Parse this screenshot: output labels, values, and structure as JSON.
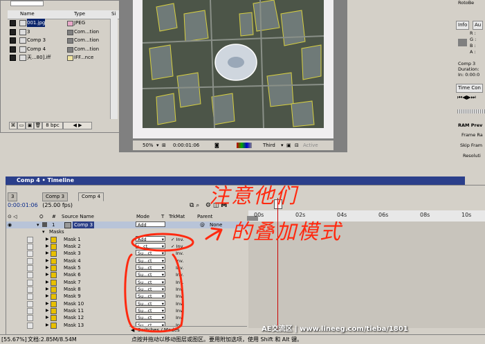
{
  "project": {
    "columns": {
      "name": "Name",
      "type": "Type",
      "size": "Si"
    },
    "items": [
      {
        "name": "001.jpg",
        "type": "JPEG",
        "swatch": "#e8a8c8",
        "selected": true
      },
      {
        "name": "3",
        "type": "Com...tion",
        "swatch": "#808080"
      },
      {
        "name": "Comp 3",
        "type": "Com...tion",
        "swatch": "#808080"
      },
      {
        "name": "Comp 4",
        "type": "Com...tion",
        "swatch": "#808080"
      },
      {
        "name": "天...80].iff",
        "type": "IFF...nce",
        "swatch": "#f0e4a0"
      }
    ],
    "bpc": "8 bpc"
  },
  "viewer": {
    "zoom": "50%",
    "timecode": "0:00:01:06",
    "resolution": "Third",
    "active_label": "Active"
  },
  "right_panel": {
    "roto_label": "RotoBe",
    "info_tab": "Info",
    "info_tab2": "Au",
    "r": "R :",
    "g": "G :",
    "b": "B :",
    "a": "A :",
    "comp_name": "Comp 3",
    "duration": "Duration:",
    "in_out": "In: 0:00:0",
    "time_controls_tab": "Time Con",
    "ram_preview": "RAM Prev",
    "frame_rate": "Frame Ra",
    "skip_frames": "Skip Fram",
    "resolution": "Resoluti"
  },
  "timeline": {
    "title": "Comp 4 • Timeline",
    "tabs": [
      "3",
      "Comp 3",
      "Comp 4"
    ],
    "timecode": "0:00:01:06",
    "fps": "(25.00 fps)",
    "columns": {
      "num": "#",
      "source": "Source Name",
      "mode": "Mode",
      "t": "T",
      "trkmat": "TrkMat",
      "parent": "Parent"
    },
    "layer": {
      "index": "1",
      "name": "Comp 3",
      "mode": "Add",
      "parent": "None"
    },
    "masks_label": "Masks",
    "masks": [
      {
        "name": "Mask 1",
        "mode": "Add",
        "inv": "Inv."
      },
      {
        "name": "Mask 2",
        "mode": "I...ct",
        "inv": "Inv."
      },
      {
        "name": "Mask 3",
        "mode": "Su...ct",
        "inv": "Inv."
      },
      {
        "name": "Mask 4",
        "mode": "Su...ct",
        "inv": "Inv."
      },
      {
        "name": "Mask 5",
        "mode": "Su...ct",
        "inv": "Inv."
      },
      {
        "name": "Mask 6",
        "mode": "Su...ct",
        "inv": "Inv."
      },
      {
        "name": "Mask 7",
        "mode": "Su...ct",
        "inv": "Inv."
      },
      {
        "name": "Mask 8",
        "mode": "Su...ct",
        "inv": "Inv."
      },
      {
        "name": "Mask 9",
        "mode": "Su...ct",
        "inv": "Inv."
      },
      {
        "name": "Mask 10",
        "mode": "Su...ct",
        "inv": "Inv."
      },
      {
        "name": "Mask 11",
        "mode": "Su...ct",
        "inv": "Inv."
      },
      {
        "name": "Mask 12",
        "mode": "Su...ct",
        "inv": "Inv."
      },
      {
        "name": "Mask 13",
        "mode": "Su...ct",
        "inv": "Inv."
      }
    ],
    "ruler_ticks": [
      "00s",
      "02s",
      "04s",
      "06s",
      "08s",
      "10s"
    ],
    "footer": "Switches / Modes",
    "annotation_line1": "注意他们",
    "annotation_line2": "的叠加模式"
  },
  "status": {
    "zoom": "[55.67%]",
    "doc": "文档:2.85M/8.54M",
    "hint": "点按并拖动以移动图层或图区。要用附加选项，使用 Shift 和 Alt 键。",
    "watermark": "AE交流区 | www.lineeg.com/tieba/1801"
  },
  "colors": {
    "title_bar": "#2b3f8b",
    "annotation": "#ff2a10",
    "playhead": "#cc0000"
  }
}
